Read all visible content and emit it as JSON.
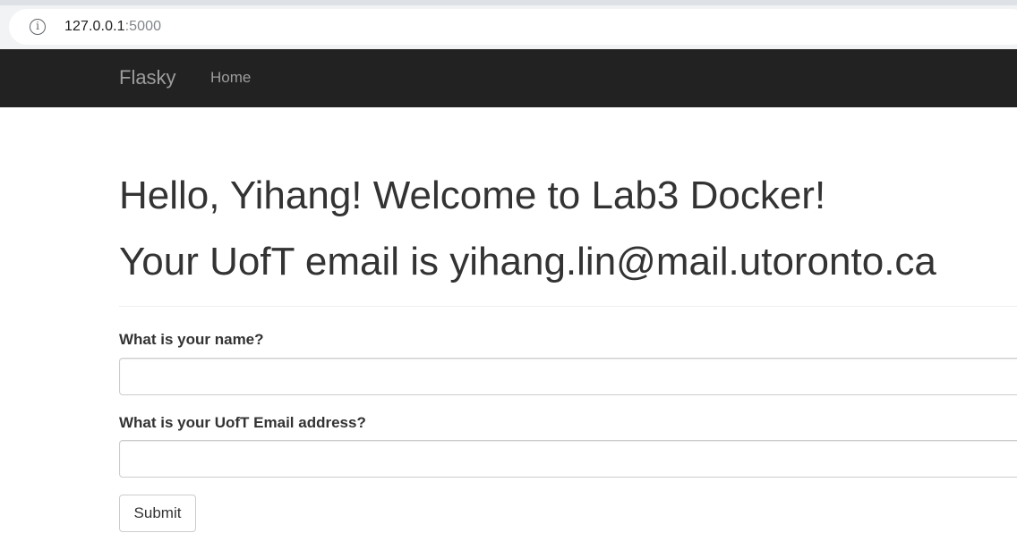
{
  "browser": {
    "url_host": "127.0.0.1",
    "url_port": ":5000",
    "info_icon": "info-icon"
  },
  "navbar": {
    "brand": "Flasky",
    "items": [
      {
        "label": "Home"
      }
    ]
  },
  "main": {
    "greeting": "Hello, Yihang! Welcome to Lab3 Docker!",
    "email_line": "Your UofT email is yihang.lin@mail.utoronto.ca",
    "form": {
      "name_label": "What is your name?",
      "name_value": "",
      "email_label": "What is your UofT Email address?",
      "email_value": "",
      "submit_label": "Submit"
    }
  },
  "colors": {
    "navbar_bg": "#222222",
    "navbar_text": "#9d9d9d",
    "heading_text": "#333333"
  }
}
